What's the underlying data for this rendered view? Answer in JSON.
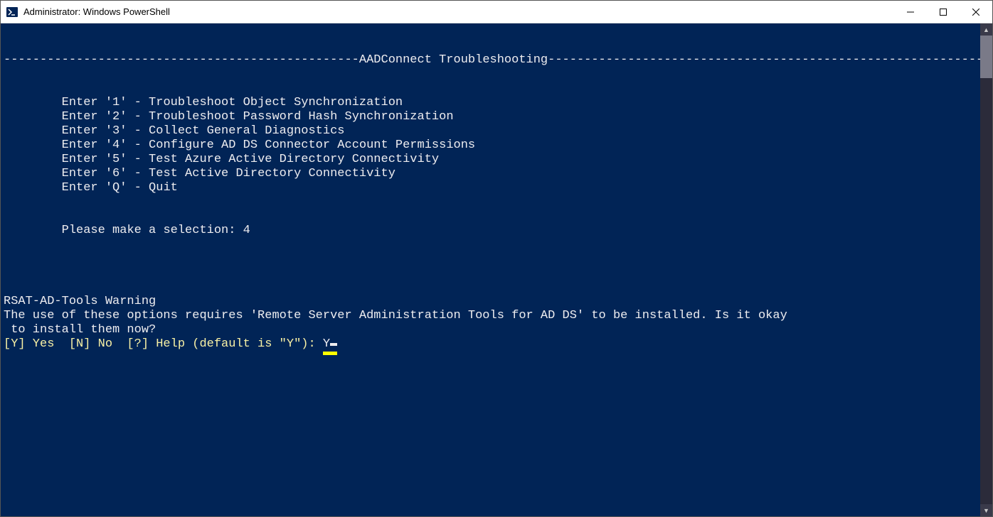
{
  "window": {
    "title": "Administrator: Windows PowerShell"
  },
  "console": {
    "header_left_dashes": "-------------------------------------------------",
    "header_title": "AADConnect Troubleshooting",
    "header_right_dashes": "-------------------------------------------------------------",
    "menu_indent": "        ",
    "menu": [
      "Enter '1' - Troubleshoot Object Synchronization",
      "Enter '2' - Troubleshoot Password Hash Synchronization",
      "Enter '3' - Collect General Diagnostics",
      "Enter '4' - Configure AD DS Connector Account Permissions",
      "Enter '5' - Test Azure Active Directory Connectivity",
      "Enter '6' - Test Active Directory Connectivity",
      "Enter 'Q' - Quit"
    ],
    "prompt_label": "Please make a selection: ",
    "prompt_value": "4",
    "warning_title": "RSAT-AD-Tools Warning",
    "warning_body_line1": "The use of these options requires 'Remote Server Administration Tools for AD DS' to be installed. Is it okay",
    "warning_body_line2": " to install them now?",
    "confirm_prompt": "[Y] Yes  [N] No  [?] Help (default is \"Y\"): ",
    "confirm_input": "Y"
  }
}
